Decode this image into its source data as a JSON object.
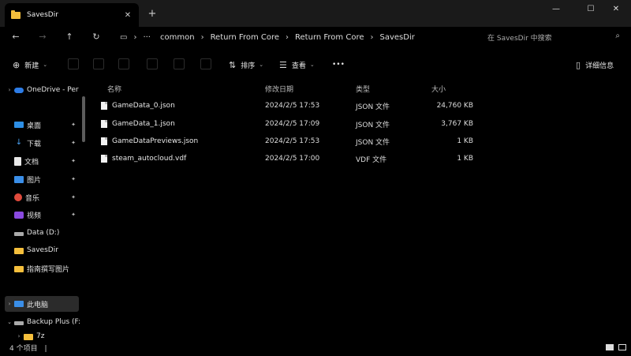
{
  "tab": {
    "title": "SavesDir"
  },
  "breadcrumb": [
    "common",
    "Return From Core",
    "Return From Core",
    "SavesDir"
  ],
  "search": {
    "placeholder": "在 SavesDir 中搜索"
  },
  "commands": {
    "new": "新建",
    "sort": "排序",
    "view": "查看",
    "more": "•••",
    "details": "详细信息"
  },
  "sidebar": {
    "onedrive": "OneDrive - Per",
    "quick": [
      {
        "label": "桌面",
        "icon": "desktop-icon",
        "pinned": true
      },
      {
        "label": "下载",
        "icon": "download-icon",
        "pinned": true
      },
      {
        "label": "文档",
        "icon": "document-icon",
        "pinned": true
      },
      {
        "label": "图片",
        "icon": "picture-icon",
        "pinned": true
      },
      {
        "label": "音乐",
        "icon": "music-icon",
        "pinned": true
      },
      {
        "label": "视频",
        "icon": "video-icon",
        "pinned": true
      },
      {
        "label": "Data (D:)",
        "icon": "drive-icon",
        "pinned": false
      },
      {
        "label": "SavesDir",
        "icon": "folder-icon",
        "pinned": false
      },
      {
        "label": "指南撰写图片",
        "icon": "folder-icon",
        "pinned": false
      }
    ],
    "this_pc": "此电脑",
    "backup": "Backup Plus (F:",
    "sub_folder": "7z"
  },
  "columns": {
    "name": "名称",
    "modified": "修改日期",
    "type": "类型",
    "size": "大小"
  },
  "files": [
    {
      "name": "GameData_0.json",
      "modified": "2024/2/5 17:53",
      "type": "JSON 文件",
      "size": "24,760 KB"
    },
    {
      "name": "GameData_1.json",
      "modified": "2024/2/5 17:09",
      "type": "JSON 文件",
      "size": "3,767 KB"
    },
    {
      "name": "GameDataPreviews.json",
      "modified": "2024/2/5 17:53",
      "type": "JSON 文件",
      "size": "1 KB"
    },
    {
      "name": "steam_autocloud.vdf",
      "modified": "2024/2/5 17:00",
      "type": "VDF 文件",
      "size": "1 KB"
    }
  ],
  "status": {
    "count": "4 个项目"
  },
  "colors": {
    "folder": "#f5bf3c",
    "background": "#000000",
    "selection": "#2b2b2b"
  }
}
